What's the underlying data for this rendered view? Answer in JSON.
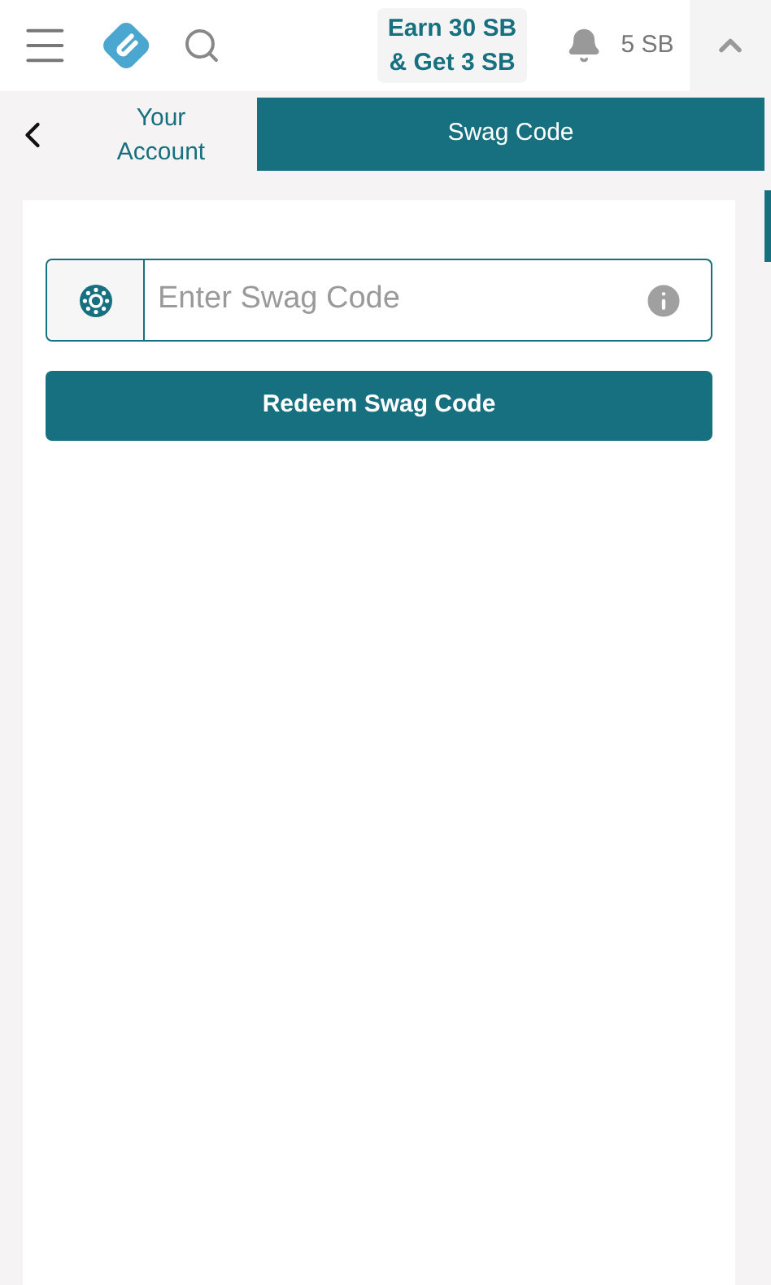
{
  "header": {
    "promo": "Earn 30 SB\n& Get 3 SB",
    "balance": "5 SB"
  },
  "tabs": [
    {
      "label": "Your Account",
      "selected": false
    },
    {
      "label": "Swag Code",
      "selected": true
    }
  ],
  "form": {
    "field": {
      "placeholder": "Enter Swag Code"
    },
    "button": "Redeem Swag Code"
  }
}
